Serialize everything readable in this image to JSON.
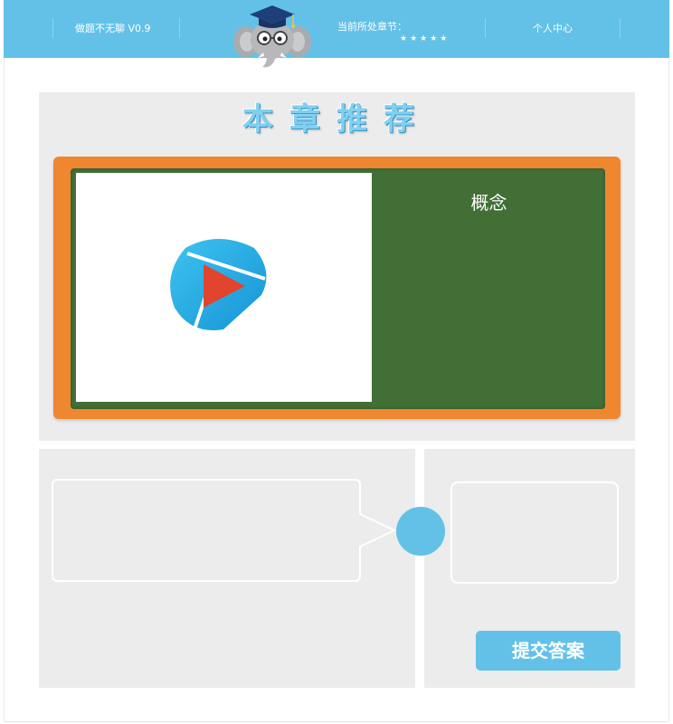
{
  "header": {
    "app_name": "做题不无聊 V0.9",
    "chapter_label": "当前所处章节：",
    "chapter_stars": "★★★★★",
    "profile_link": "个人中心"
  },
  "main": {
    "heading": "本章推荐",
    "concept_label": "概念"
  },
  "actions": {
    "submit_label": "提交答案"
  },
  "colors": {
    "brand_blue": "#63c1e8",
    "board_orange": "#ef8630",
    "board_green": "#416f36",
    "panel_gray": "#ececec"
  }
}
